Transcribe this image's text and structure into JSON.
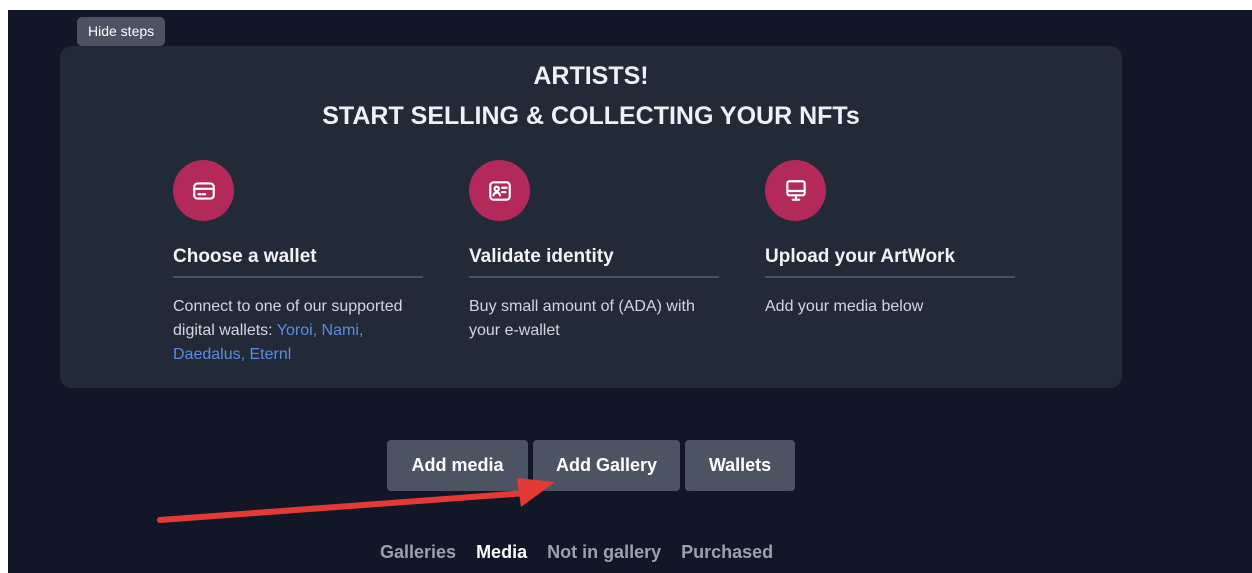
{
  "toggle": {
    "label": "Hide steps"
  },
  "banner": {
    "title_line1": "ARTISTS!",
    "title_line2": "START SELLING & COLLECTING YOUR NFTs",
    "accent_color": "#b32a5a",
    "steps": [
      {
        "icon": "credit-card-icon",
        "title": "Choose a wallet",
        "desc_text": "Connect to one of our supported digital wallets: ",
        "desc_link": "Yoroi, Nami, Daedalus, Eternl"
      },
      {
        "icon": "id-card-icon",
        "title": "Validate identity",
        "desc_text": "Buy small amount of (ADA) with your e-wallet"
      },
      {
        "icon": "monitor-icon",
        "title": "Upload your ArtWork",
        "desc_text": "Add your media below"
      }
    ]
  },
  "actions": {
    "add_media": "Add media",
    "add_gallery": "Add Gallery",
    "wallets": "Wallets"
  },
  "tabs": [
    {
      "label": "Galleries",
      "active": false
    },
    {
      "label": "Media",
      "active": true
    },
    {
      "label": "Not in gallery",
      "active": false
    },
    {
      "label": "Purchased",
      "active": false
    }
  ],
  "annotation": {
    "arrow_color": "#e53935"
  }
}
